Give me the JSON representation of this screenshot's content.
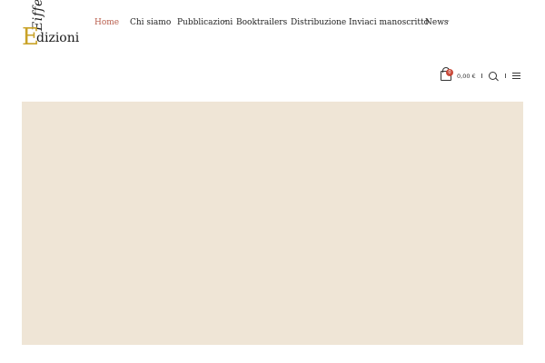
{
  "logo": {
    "line1": "Eiffel",
    "initial": "E",
    "line2": "dizioni"
  },
  "nav": {
    "items": [
      {
        "label": "Home",
        "active": true
      },
      {
        "label": "Chi siamo"
      },
      {
        "label": "Pubblicazioni",
        "has_dropdown": true
      },
      {
        "label": "Booktrailers"
      },
      {
        "label": "Distribuzione"
      },
      {
        "label": "Inviaci manoscritto"
      },
      {
        "label": "News",
        "has_dropdown": true
      }
    ],
    "active_color": "#b85c4b",
    "caret_glyph": "⌄"
  },
  "cart": {
    "count": "0",
    "total": "0,00 €"
  },
  "icons": {
    "cart": "shopping-bag-icon",
    "search": "search-icon",
    "menu": "hamburger-menu-icon"
  },
  "hero": {
    "background": "#efe5d6"
  }
}
